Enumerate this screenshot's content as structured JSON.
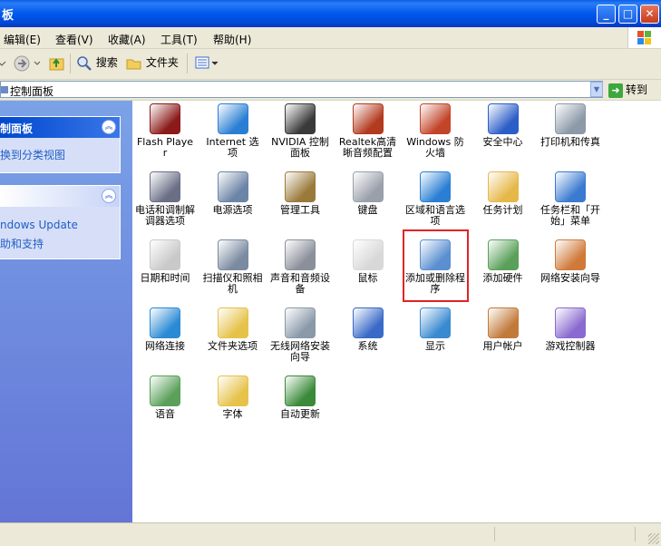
{
  "window": {
    "title": "板"
  },
  "menu": [
    {
      "label": "编辑(E)"
    },
    {
      "label": "查看(V)"
    },
    {
      "label": "收藏(A)"
    },
    {
      "label": "工具(T)"
    },
    {
      "label": "帮助(H)"
    }
  ],
  "toolbar": {
    "search_label": "搜索",
    "folders_label": "文件夹"
  },
  "address": {
    "value": "控制面板",
    "go_label": "转到"
  },
  "leftpane": {
    "panel1": {
      "title": "制面板",
      "link": "换到分类视图"
    },
    "panel2": {
      "links": [
        "ndows Update",
        "助和支持"
      ]
    }
  },
  "items": [
    {
      "label": "Flash Player",
      "icon": "flash-icon",
      "color": "#8b1a1a"
    },
    {
      "label": "Internet 选项",
      "icon": "internet-options-icon",
      "color": "#2a7fd4"
    },
    {
      "label": "NVIDIA 控制面板",
      "icon": "nvidia-icon",
      "color": "#3a3a3a"
    },
    {
      "label": "Realtek高清晰音频配置",
      "icon": "realtek-audio-icon",
      "color": "#b23a1e"
    },
    {
      "label": "Windows 防火墙",
      "icon": "firewall-icon",
      "color": "#c2452a"
    },
    {
      "label": "安全中心",
      "icon": "security-center-icon",
      "color": "#2c5ec8"
    },
    {
      "label": "打印机和传真",
      "icon": "printer-icon",
      "color": "#8b99a8"
    },
    {
      "label": "电话和调制解调器选项",
      "icon": "phone-modem-icon",
      "color": "#6a6f86"
    },
    {
      "label": "电源选项",
      "icon": "power-options-icon",
      "color": "#6c84a6"
    },
    {
      "label": "管理工具",
      "icon": "admin-tools-icon",
      "color": "#9a7a3a"
    },
    {
      "label": "键盘",
      "icon": "keyboard-icon",
      "color": "#9aa0aa"
    },
    {
      "label": "区域和语言选项",
      "icon": "region-language-icon",
      "color": "#2a7fd4"
    },
    {
      "label": "任务计划",
      "icon": "scheduled-tasks-icon",
      "color": "#e6b84a"
    },
    {
      "label": "任务栏和「开始」菜单",
      "icon": "taskbar-icon",
      "color": "#3a7ad0"
    },
    {
      "label": "日期和时间",
      "icon": "date-time-icon",
      "color": "#c9c9c9"
    },
    {
      "label": "扫描仪和照相机",
      "icon": "scanner-camera-icon",
      "color": "#7a8aa0"
    },
    {
      "label": "声音和音频设备",
      "icon": "sound-icon",
      "color": "#8a8f99"
    },
    {
      "label": "鼠标",
      "icon": "mouse-icon",
      "color": "#d8d8d8"
    },
    {
      "label": "添加或删除程序",
      "icon": "add-remove-programs-icon",
      "color": "#5a8fd0"
    },
    {
      "label": "添加硬件",
      "icon": "add-hardware-icon",
      "color": "#5aa05a"
    },
    {
      "label": "网络安装向导",
      "icon": "network-setup-icon",
      "color": "#d07a3a"
    },
    {
      "label": "网络连接",
      "icon": "network-connections-icon",
      "color": "#2a8ad4"
    },
    {
      "label": "文件夹选项",
      "icon": "folder-options-icon",
      "color": "#e6c24a"
    },
    {
      "label": "无线网络安装向导",
      "icon": "wireless-setup-icon",
      "color": "#8a99aa"
    },
    {
      "label": "系统",
      "icon": "system-icon",
      "color": "#3a6ac8"
    },
    {
      "label": "显示",
      "icon": "display-icon",
      "color": "#3a8ad0"
    },
    {
      "label": "用户帐户",
      "icon": "user-accounts-icon",
      "color": "#c27a3a"
    },
    {
      "label": "游戏控制器",
      "icon": "game-controller-icon",
      "color": "#8a6ad0"
    },
    {
      "label": "语音",
      "icon": "speech-icon",
      "color": "#5aa05a"
    },
    {
      "label": "字体",
      "icon": "fonts-icon",
      "color": "#e6c24a"
    },
    {
      "label": "自动更新",
      "icon": "automatic-updates-icon",
      "color": "#3a8a3a"
    }
  ],
  "selected_item": "添加或删除程序"
}
